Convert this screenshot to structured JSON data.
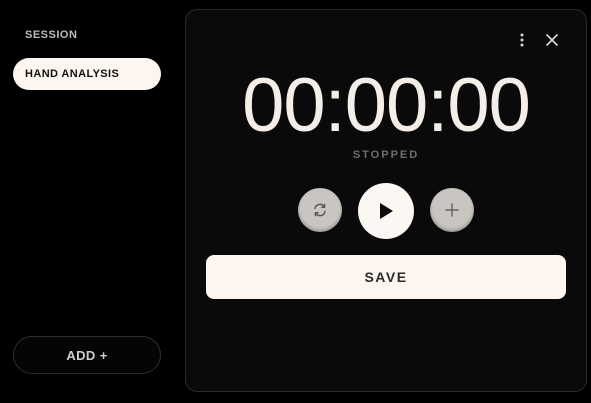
{
  "sidebar": {
    "header": "SESSION",
    "items": [
      {
        "label": "HAND ANALYSIS",
        "active": true
      }
    ],
    "add_label": "ADD +"
  },
  "timer": {
    "time": "00:00:00",
    "status": "STOPPED",
    "controls": {
      "reset_icon": "refresh-icon",
      "play_icon": "play-icon",
      "add_icon": "plus-icon"
    },
    "save_label": "SAVE"
  },
  "panel": {
    "menu_icon": "more-vertical-icon",
    "close_icon": "close-icon"
  },
  "colors": {
    "background": "#000000",
    "panel": "#0a0a0a",
    "accent_light": "#fdf6f0",
    "muted_button": "#c9c5c1",
    "status_text": "#6e6e6e"
  }
}
